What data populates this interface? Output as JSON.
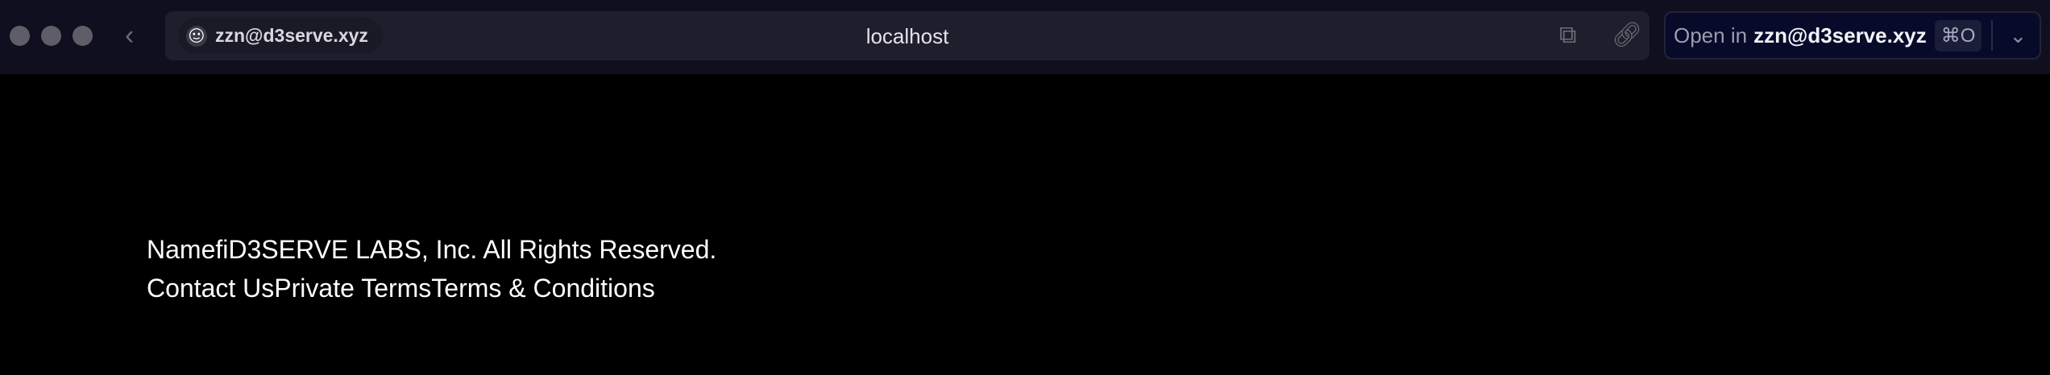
{
  "browser": {
    "profile": "zzn@d3serve.xyz",
    "address": "localhost",
    "open_in": {
      "prefix": "Open in",
      "target": "zzn@d3serve.xyz",
      "shortcut": "⌘O"
    }
  },
  "footer": {
    "copyright": "NamefiD3SERVE LABS, Inc. All Rights Reserved.",
    "links": [
      "Contact Us",
      "Private Terms",
      "Terms & Conditions"
    ]
  }
}
